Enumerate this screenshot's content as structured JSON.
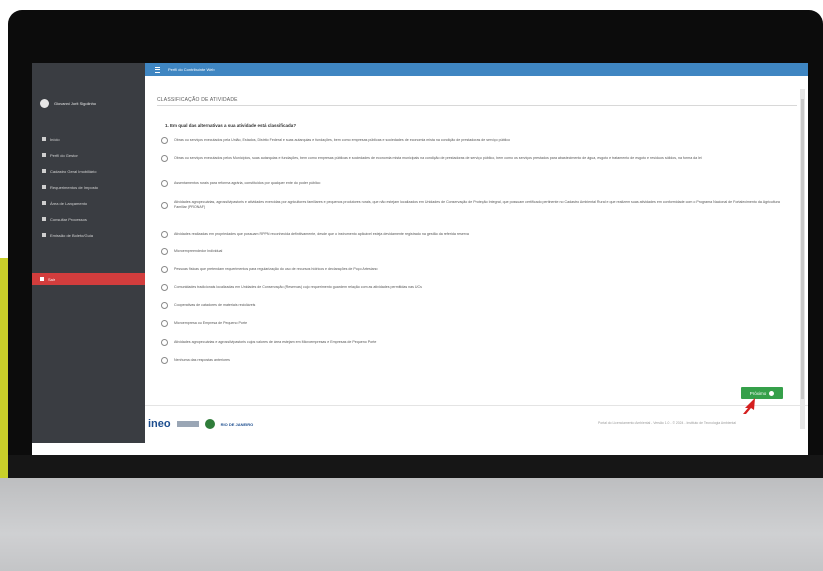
{
  "app": {
    "topbar_title": "Perfil do Contribuinte Web"
  },
  "sidebar": {
    "user_name": "Giovanni Jorit Sigolinho",
    "items": [
      {
        "label": "Início",
        "icon": "home-icon"
      },
      {
        "label": "Perfil do Gestor",
        "icon": "user-icon"
      },
      {
        "label": "Cadastro Geral Imobiliário",
        "icon": "document-icon"
      },
      {
        "label": "Requerimentos de Imposto",
        "icon": "document-icon"
      },
      {
        "label": "Área de Lançamento",
        "icon": "grid-icon"
      },
      {
        "label": "Consultar Processos",
        "icon": "document-icon"
      },
      {
        "label": "Emissão de Boleto/Guia",
        "icon": "print-icon"
      }
    ],
    "logout_label": "Sair"
  },
  "content": {
    "section_title": "CLASSIFICAÇÃO DE ATIVIDADE",
    "question": "1. Em qual das alternativas a sua atividade está classificada?",
    "options": [
      "Obras ou serviços executados pela União, Estados, Distrito Federal e suas autarquias e fundações, bem como empresas públicas e sociedades de economia mista na condição de prestadoras de serviço público",
      "Obras ou serviços executados pelos Municípios, suas autarquias e fundações, bem como empresas públicas e sociedades de economia mista municipais na condição de prestadoras de serviço público, bem como os serviços prestados para abastecimento de água, esgoto e tratamento de esgoto e resíduos sólidos, na forma da lei",
      "Assentamentos rurais para reforma agrária, constituídos por qualquer ente do poder público",
      "Atividades agropecuárias, agrossilvipastoris e atividades exercidas por agricultores familiares e pequenos produtores rurais, que não estejam localizados em Unidades de Conservação de Proteção Integral, que possuam certificado pertinente no Cadastro Ambiental Rural e que realizem suas atividades em conformidade com o Programa Nacional de Fortalecimento da Agricultura Familiar (PRONAF)",
      "Atividades realizadas em propriedades que possuam RPPN reconhecida definitivamente, desde que o instrumento aplicável esteja devidamente registrado na gestão da referida reserva",
      "Microempreendedor Individual",
      "Pessoas físicas que pretendam requerimentos para regularização do uso de recursos hídricos e declarações de Poço Artesiano",
      "Comunidades tradicionais localizadas em Unidades de Conservação (Reservas) cujo requerimento guardem relação com as atividades permitidas nas UCs",
      "Cooperativas de catadores de materiais recicláveis",
      "Microempresa ou Empresa de Pequeno Porte",
      "Atividades agropecuárias e agrossilvipastoris cujos valores de área estejam em Microempresas e Empresas de Pequeno Porte",
      "Nenhuma das respostas anteriores"
    ],
    "next_label": "Próximo"
  },
  "footer": {
    "logo_text": "ineo",
    "city_text": "RIO DE JANEIRO",
    "credit": "Portal do Licenciamento Ambiental - Versão 1.0 - © 2024 - Instituto de Tecnologia Ambiental"
  },
  "colors": {
    "topbar": "#3f86c2",
    "sidebar": "#3a3d42",
    "logout": "#d23d3d",
    "next_button": "#35a04a",
    "accent_strip": "#c9cf2a"
  }
}
